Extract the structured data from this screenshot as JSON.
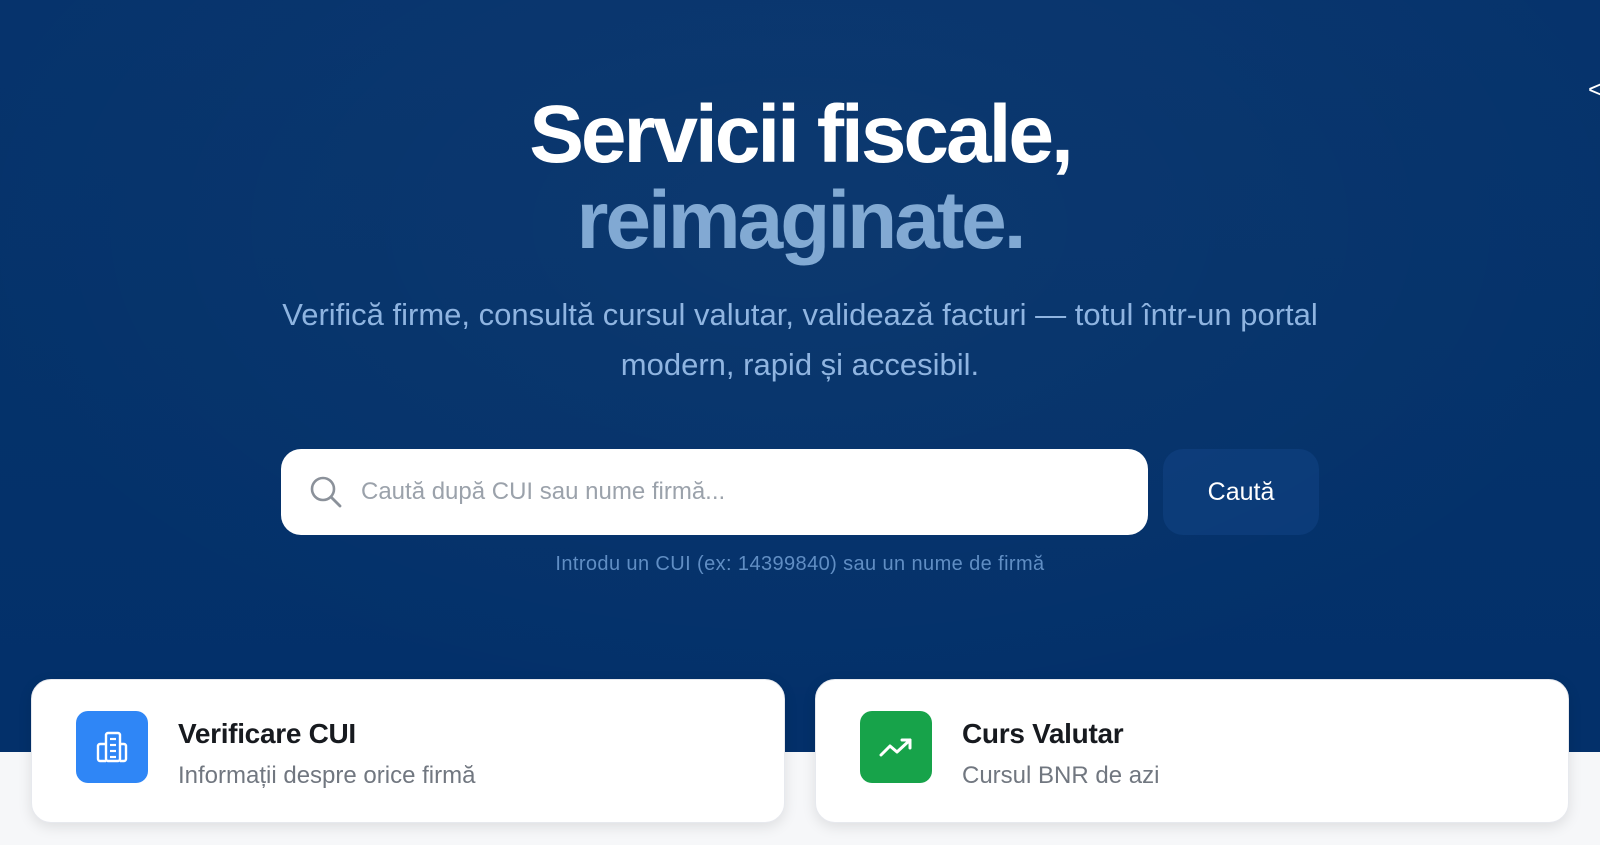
{
  "hero": {
    "title_line1": "Servicii fiscale,",
    "title_line2": "reimaginate.",
    "subtitle": "Verifică firme, consultă cursul valutar, validează facturi — totul într-un portal modern, rapid și accesibil."
  },
  "search": {
    "placeholder": "Caută după CUI sau nume firmă...",
    "value": "",
    "button_label": "Caută",
    "hint": "Introdu un CUI (ex: 14399840) sau un nume de firmă"
  },
  "cards": [
    {
      "title": "Verificare CUI",
      "subtitle": "Informații despre orice firmă",
      "icon": "building-icon",
      "color": "#2f86f6"
    },
    {
      "title": "Curs Valutar",
      "subtitle": "Cursul BNR de azi",
      "icon": "trending-up-icon",
      "color": "#17a34a"
    }
  ],
  "colors": {
    "hero_bg": "#04326a",
    "accent_title": "#7ea7d2",
    "button_bg": "#0a3a78"
  }
}
